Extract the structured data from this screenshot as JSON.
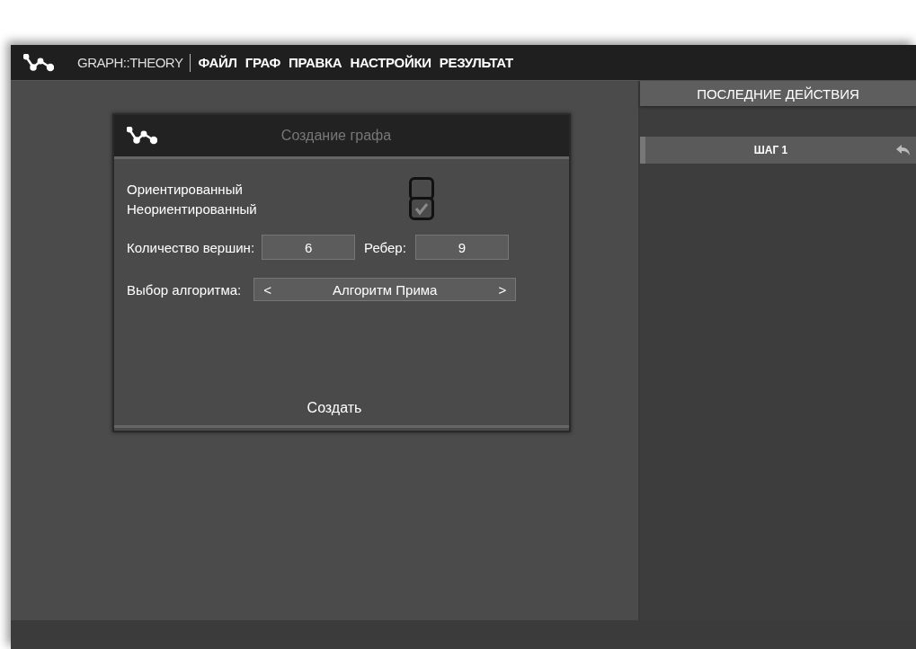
{
  "menubar": {
    "app_name": "GRAPH::THEORY",
    "menus": [
      "ФАЙЛ",
      "ГРАФ",
      "ПРАВКА",
      "НАСТРОЙКИ",
      "РЕЗУЛЬТАТ"
    ]
  },
  "dialog": {
    "title": "Создание графа",
    "graph_types": [
      {
        "label": "Ориентированный",
        "checked": false
      },
      {
        "label": "Неориентированный",
        "checked": true
      }
    ],
    "vertices": {
      "label": "Количество вершин:",
      "value": "6"
    },
    "edges": {
      "label": "Ребер:",
      "value": "9"
    },
    "algorithm": {
      "label": "Выбор алгоритма:",
      "prev": "<",
      "value": "Алгоритм Прима",
      "next": ">"
    },
    "create_button": "Создать"
  },
  "history": {
    "title": "ПОСЛЕДНИЕ ДЕЙСТВИЯ",
    "steps": [
      {
        "label": "ШАГ 1"
      }
    ]
  }
}
